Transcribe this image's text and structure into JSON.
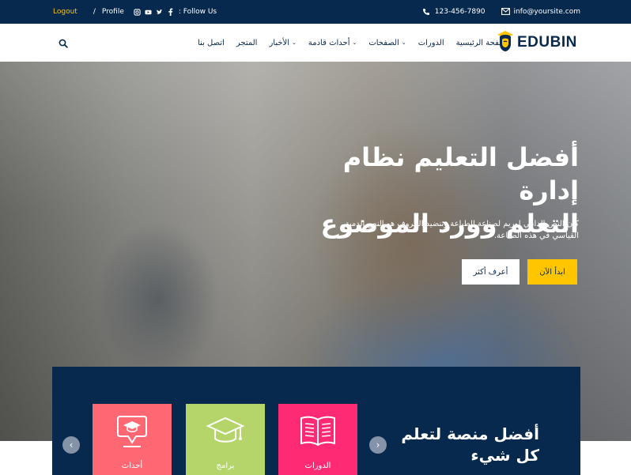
{
  "topbar": {
    "logout": "Logout",
    "separator": "/",
    "profile": "Profile",
    "follow": ": Follow Us",
    "social_icons": [
      "instagram-icon",
      "youtube-icon",
      "twitter-icon",
      "facebook-icon"
    ],
    "phone": "123-456-7890",
    "email": "info@yoursite.com"
  },
  "header": {
    "logo": "EDUBIN",
    "nav": [
      {
        "label": "الصفحة الرئيسية",
        "dropdown": false
      },
      {
        "label": "الدورات",
        "dropdown": false
      },
      {
        "label": "الصفحات",
        "dropdown": true
      },
      {
        "label": "أحداث قادمة",
        "dropdown": true
      },
      {
        "label": "الأخبار",
        "dropdown": true
      },
      {
        "label": "المتجر",
        "dropdown": false
      },
      {
        "label": "اتصل بنا",
        "dropdown": false
      }
    ]
  },
  "hero": {
    "title_line1": "أفضل التعليم نظام إدارة",
    "title_line2": "التعلم وورد الموضوع",
    "description": "كان النص الدامي لوريم لصناعة الطباعة وتنضيد الحروف هو النص الدمية القياسي في هذه الصناعة.",
    "btn_start": "ابدأ الآن",
    "btn_more": "أعرف أكثر"
  },
  "panel": {
    "title": "أفضل منصة لتعلم كل شيء",
    "cards": [
      {
        "label": "الدورات",
        "icon": "book-icon"
      },
      {
        "label": "برامج",
        "icon": "graduation-cap-icon"
      },
      {
        "label": "أحداث",
        "icon": "event-icon"
      }
    ]
  },
  "colors": {
    "navy": "#07294d",
    "yellow": "#ffc600",
    "pink": "#fe2b74",
    "green": "#b5d56a",
    "coral": "#ff6773"
  }
}
